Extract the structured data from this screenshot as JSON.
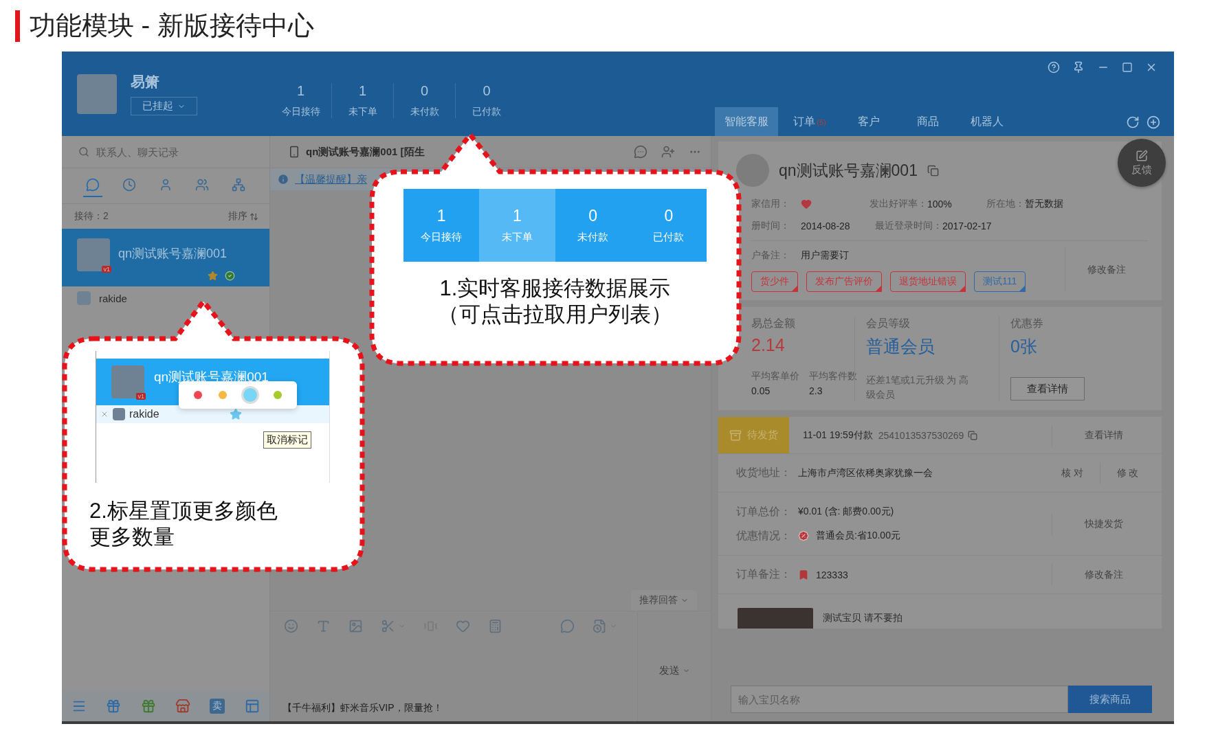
{
  "slide_title": "功能模块 - 新版接待中心",
  "header": {
    "user_name": "易箫",
    "status": "已挂起",
    "stats": [
      {
        "value": "1",
        "label": "今日接待"
      },
      {
        "value": "1",
        "label": "未下单"
      },
      {
        "value": "0",
        "label": "未付款"
      },
      {
        "value": "0",
        "label": "已付款"
      }
    ],
    "tabs": [
      {
        "label": "智能客服",
        "selected": true
      },
      {
        "label": "订单",
        "badge": "(5)",
        "selected": false
      },
      {
        "label": "客户",
        "selected": false
      },
      {
        "label": "商品",
        "selected": false
      },
      {
        "label": "机器人",
        "selected": false
      }
    ]
  },
  "contacts_panel": {
    "search": {
      "placeholder": "联系人、聊天记录"
    },
    "filters": [
      {
        "kind": "chat",
        "selected": true
      },
      {
        "kind": "recent",
        "selected": false
      },
      {
        "kind": "contact",
        "selected": false
      },
      {
        "kind": "group",
        "selected": false
      },
      {
        "kind": "team",
        "selected": false
      }
    ],
    "count": "接待：2",
    "sort": "排序",
    "contacts": [
      {
        "name": "qn测试账号嘉澜001",
        "badge": "v1",
        "selected": true,
        "starred": true,
        "online": true
      },
      {
        "name": "rakide",
        "selected": false,
        "starred": false,
        "online": false
      }
    ],
    "toolbar_tile": "卖"
  },
  "chat": {
    "title": "qn测试账号嘉澜001 [陌生",
    "notice": "【温馨提醒】亲",
    "suggest": "推荐回答",
    "send": "发送",
    "promo": "【千牛福利】虾米音乐VIP，限量抢！"
  },
  "customer": {
    "name": "qn测试账号嘉澜001",
    "feedback": "反馈",
    "credit_label": "家信用：",
    "good_rate_label": "发出好评率：",
    "good_rate": "100%",
    "location_label": "所在地：",
    "location": "暂无数据",
    "reg_label": "册时间：",
    "reg_date": "2014-08-28",
    "login_label": "最近登录时间：",
    "login_date": "2017-02-17",
    "note_label": "户备注：",
    "note": "用户需要订",
    "tags": [
      {
        "label": "货少件",
        "color": "#c8333b"
      },
      {
        "label": "发布广告评价",
        "color": "#c8333b"
      },
      {
        "label": "退货地址错误",
        "color": "#c8333b"
      },
      {
        "label": "测试111",
        "color": "#2f69a6"
      }
    ],
    "edit_note": "修改备注"
  },
  "customer_stats": {
    "total_label": "易总金额",
    "total": "2.14",
    "level_label": "会员等级",
    "level_name": "普通会员",
    "coupon_label": "优惠券",
    "coupons": "0张",
    "avg_price_label": "平均客单价",
    "avg_price": "0.05",
    "avg_items_label": "平均客件数",
    "avg_items": "2.3",
    "upgrade_hint": "还差1笔或1元升级 为 高级会员",
    "details": "查看详情"
  },
  "order": {
    "status": "待发货",
    "paid_time": "11-01 19:59付款",
    "order_no": "2541013537530269",
    "details": "查看详情",
    "address_label": "收货地址：",
    "address": "上海市卢湾区依稀奥家犹豫一会",
    "verify": "核 对",
    "modify": "修 改",
    "total_label": "订单总价：",
    "total": "¥0.01 (含: 邮费0.00元)",
    "discount_label": "优惠情况：",
    "discount": "普通会员:省10.00元",
    "ship": "快捷发货",
    "remark_label": "订单备注：",
    "remark": "123333",
    "edit_remark": "修改备注",
    "product": "测试宝贝 请不要拍"
  },
  "product_search": {
    "placeholder": "输入宝贝名称",
    "button": "搜索商品"
  },
  "callout_stats": {
    "stats": [
      {
        "value": "1",
        "label": "今日接待",
        "selected": false
      },
      {
        "value": "1",
        "label": "未下单",
        "selected": true
      },
      {
        "value": "0",
        "label": "未付款",
        "selected": false
      },
      {
        "value": "0",
        "label": "已付款",
        "selected": false
      }
    ],
    "lines": [
      "1.实时客服接待数据展示",
      "（可点击拉取用户列表）"
    ]
  },
  "callout_star": {
    "contact": "qn测试账号嘉澜001",
    "badge": "v1",
    "contact2": "rakide",
    "colors": [
      {
        "color": "#f0464f",
        "selected": false
      },
      {
        "color": "#f5b842",
        "selected": false
      },
      {
        "color": "#7ad6f7",
        "selected": true
      },
      {
        "color": "#a8cb2c",
        "selected": false
      }
    ],
    "tooltip": "取消标记",
    "lines": [
      "2.标星置顶更多颜色",
      "更多数量"
    ]
  }
}
